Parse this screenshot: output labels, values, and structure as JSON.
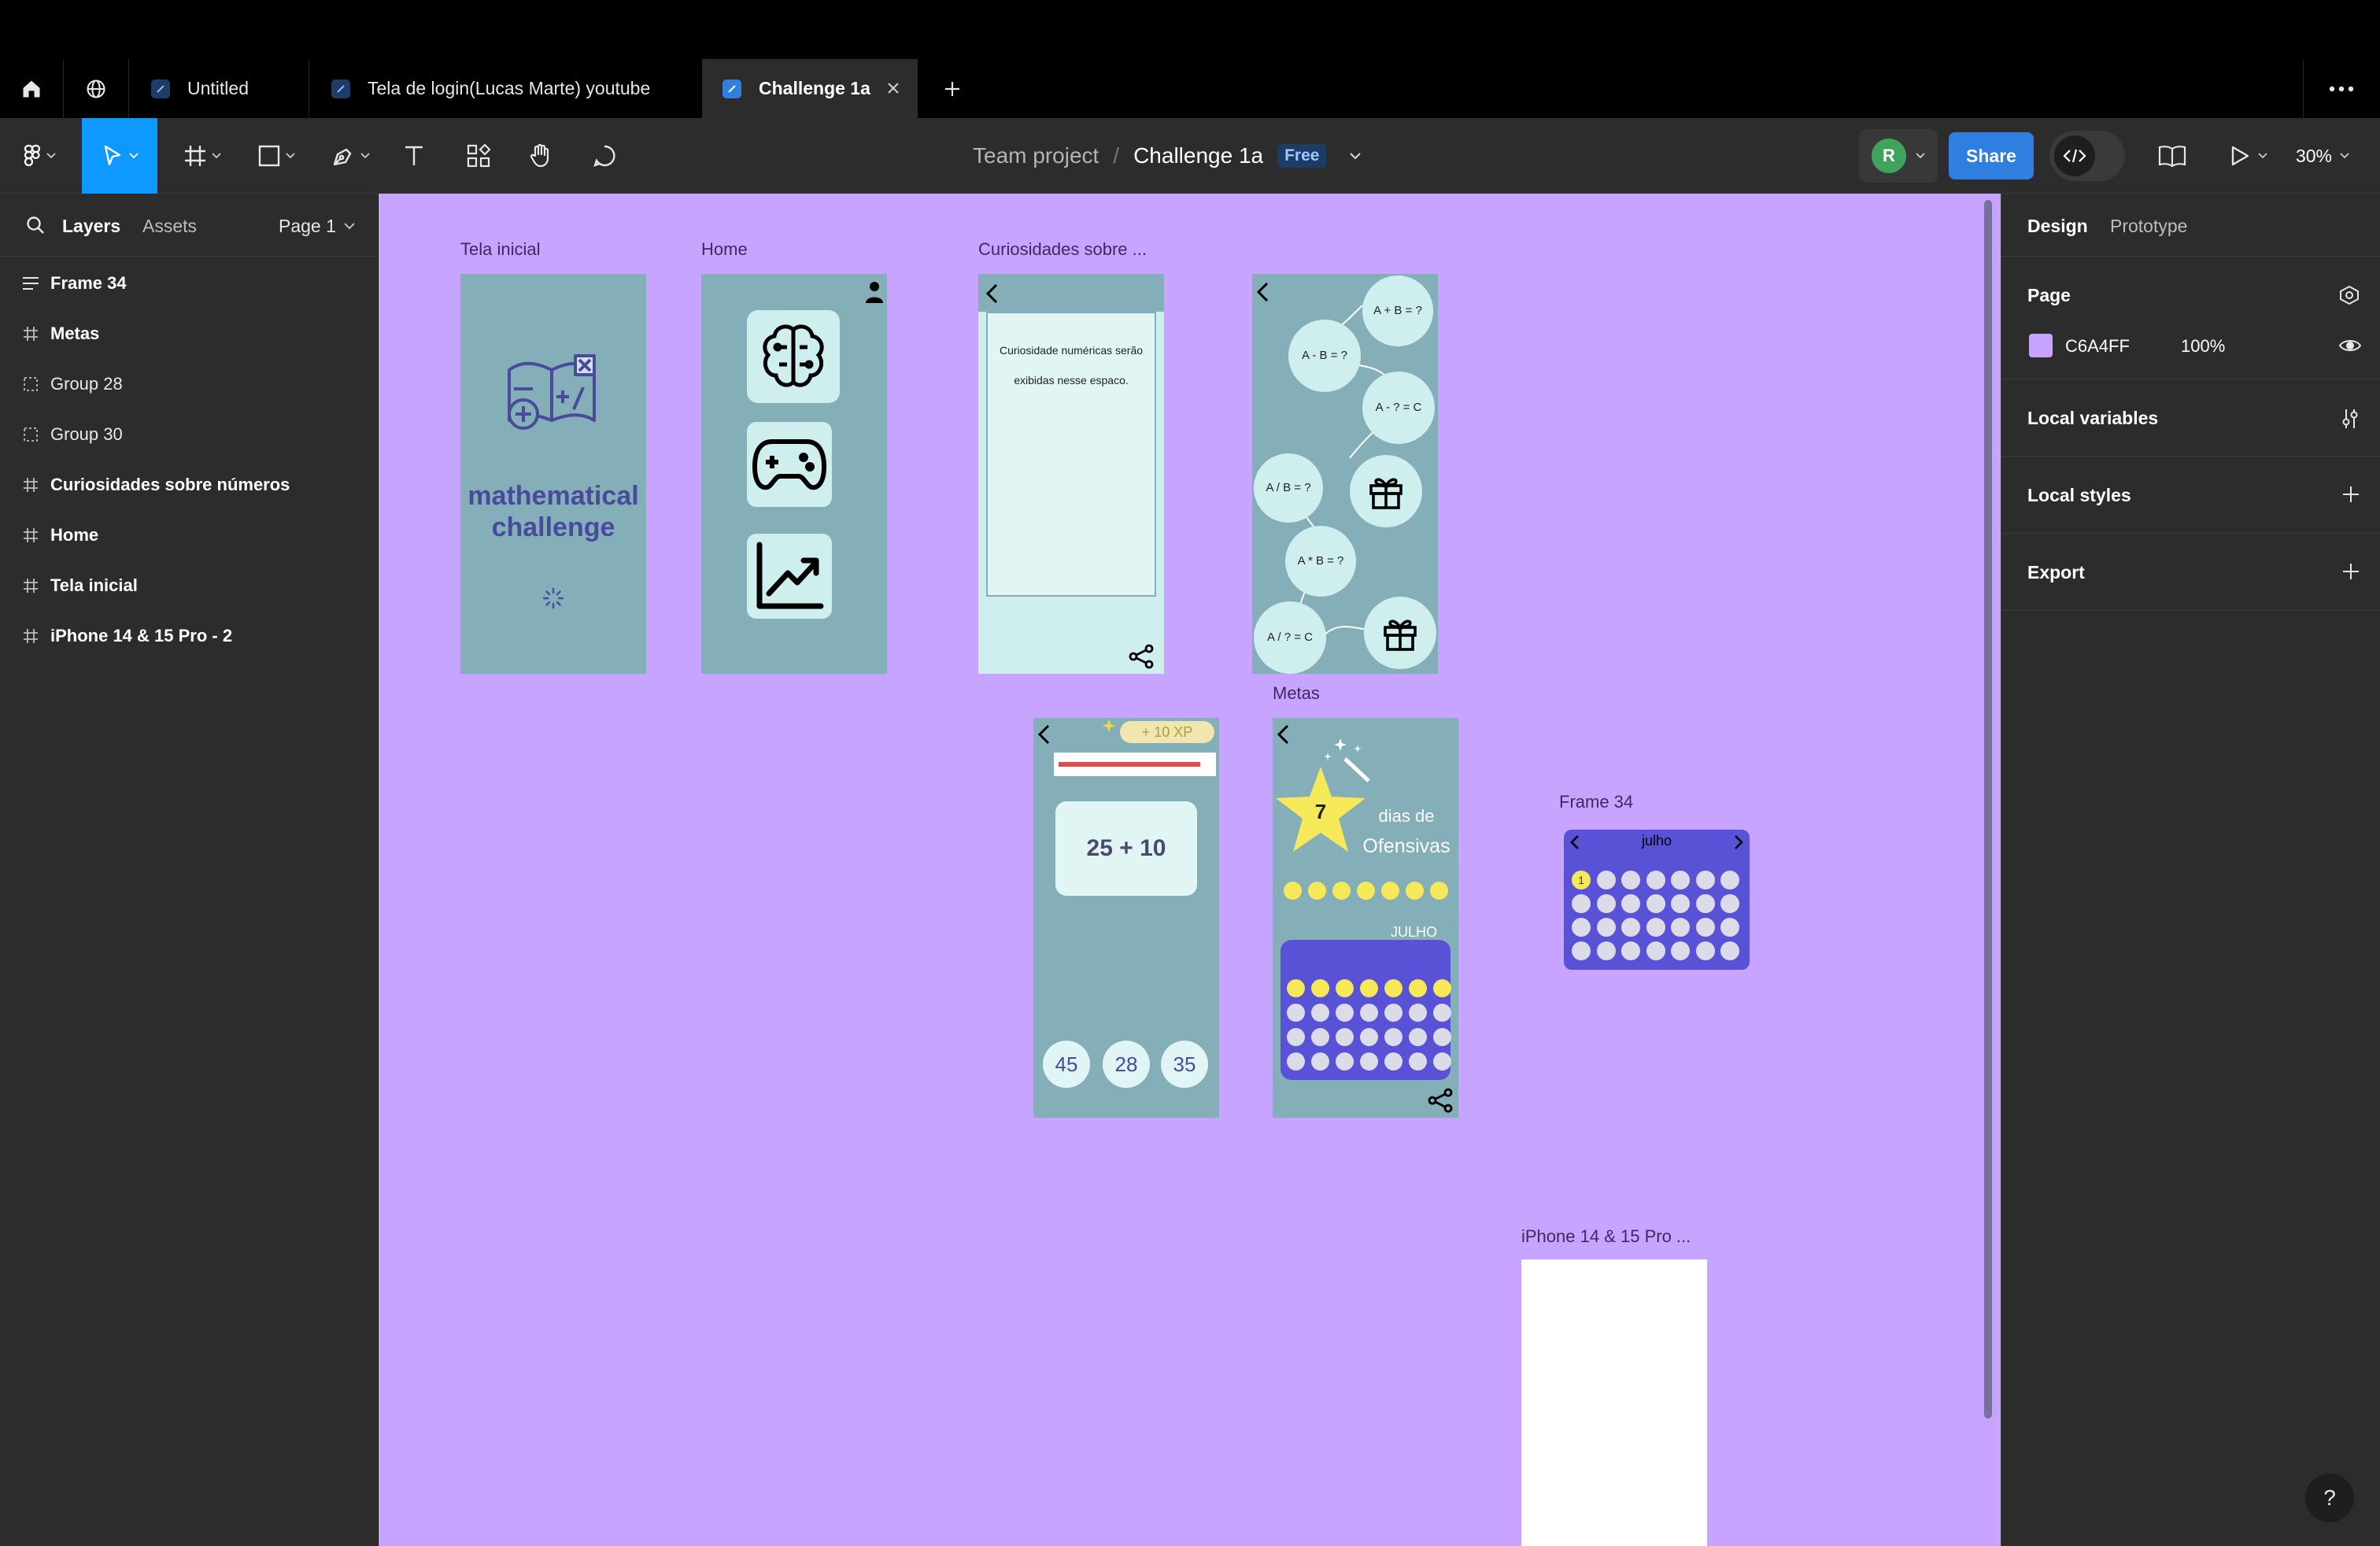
{
  "tabs": [
    {
      "label": "Untitled"
    },
    {
      "label": "Tela de login(Lucas Marte) youtube"
    },
    {
      "label": "Challenge 1a"
    }
  ],
  "toolbar": {
    "project": "Team project",
    "separator": "/",
    "file": "Challenge 1a",
    "plan_badge": "Free",
    "avatar_initial": "R",
    "share_label": "Share",
    "zoom": "30%"
  },
  "left_panel": {
    "tab_layers": "Layers",
    "tab_assets": "Assets",
    "page": "Page 1",
    "layers": [
      {
        "name": "Frame 34",
        "icon": "auto-layout-icon"
      },
      {
        "name": "Metas",
        "icon": "frame-icon"
      },
      {
        "name": "Group 28",
        "icon": "group-icon"
      },
      {
        "name": "Group 30",
        "icon": "group-icon"
      },
      {
        "name": "Curiosidades sobre números",
        "icon": "frame-icon"
      },
      {
        "name": "Home",
        "icon": "frame-icon"
      },
      {
        "name": "Tela inicial",
        "icon": "frame-icon"
      },
      {
        "name": "iPhone 14 & 15 Pro - 2",
        "icon": "frame-icon"
      }
    ]
  },
  "right_panel": {
    "tab_design": "Design",
    "tab_prototype": "Prototype",
    "page_title": "Page",
    "page_color": "C6A4FF",
    "page_opacity": "100%",
    "local_variables": "Local variables",
    "local_styles": "Local styles",
    "export": "Export"
  },
  "canvas": {
    "background": "#c6a4ff",
    "frames": {
      "tela_inicial": {
        "label": "Tela inicial",
        "title_line1": "mathematical",
        "title_line2": "challenge"
      },
      "home": {
        "label": "Home"
      },
      "curiosidades": {
        "label": "Curiosidades sobre ...",
        "text_line1": "Curiosidade numéricas serão",
        "text_line2": "exibidas nesse espaco."
      },
      "map": {
        "nodes": [
          "A + B = ?",
          "A - B = ?",
          "A - ? = C",
          "A / B = ?",
          "A * B = ?",
          "A / ? = C"
        ]
      },
      "quiz": {
        "xp": "+ 10 XP",
        "question": "25  + 10",
        "options": [
          "45",
          "28",
          "35"
        ]
      },
      "metas": {
        "label": "Metas",
        "streak": "7",
        "streak_text_1": "dias de",
        "streak_text_2": "Ofensivas",
        "month": "JULHO",
        "highlighted_days": 7,
        "total_days": 28
      },
      "frame34": {
        "label": "Frame 34",
        "month": "julho",
        "today": "1"
      },
      "iphone": {
        "label": "iPhone 14 & 15 Pro ..."
      }
    }
  },
  "colors": {
    "accent": "#0d99ff",
    "share": "#2f7fe0",
    "frame_teal": "#84aeb8",
    "light_teal": "#cfeeee",
    "calendar_blue": "#5a52d6",
    "yellow": "#f5e95a",
    "avatar_green": "#3fa35b"
  }
}
